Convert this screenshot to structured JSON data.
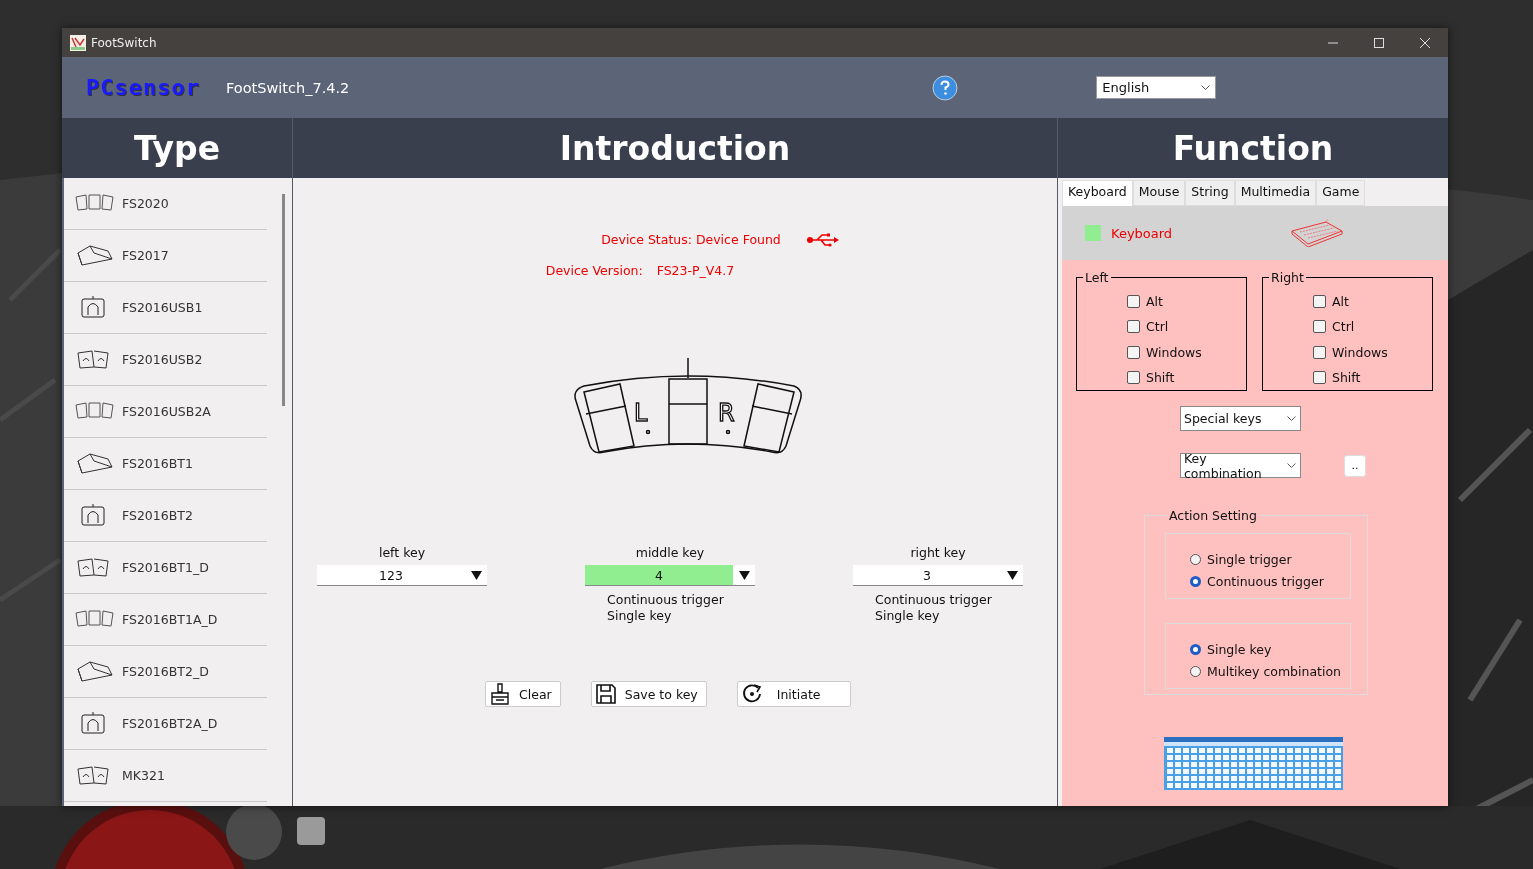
{
  "window": {
    "title": "FootSwitch"
  },
  "header": {
    "logo": "PCsensor",
    "app_version": "FootSwitch_7.4.2",
    "language": "English"
  },
  "columns": {
    "type": "Type",
    "introduction": "Introduction",
    "function": "Function"
  },
  "types": [
    {
      "label": "FS2020"
    },
    {
      "label": "FS2017"
    },
    {
      "label": "FS2016USB1"
    },
    {
      "label": "FS2016USB2"
    },
    {
      "label": "FS2016USB2A"
    },
    {
      "label": "FS2016BT1"
    },
    {
      "label": "FS2016BT2"
    },
    {
      "label": "FS2016BT1_D"
    },
    {
      "label": "FS2016BT1A_D"
    },
    {
      "label": "FS2016BT2_D"
    },
    {
      "label": "FS2016BT2A_D"
    },
    {
      "label": "MK321"
    }
  ],
  "device": {
    "status": "Device Status: Device Found",
    "version_label": "Device Version:",
    "version": "FS23-P_V4.7"
  },
  "pedal_letters": [
    "L",
    "R"
  ],
  "keys": [
    {
      "label": "left key",
      "value": "123",
      "selected": false
    },
    {
      "label": "middle key",
      "value": "4",
      "selected": true,
      "details": [
        "Continuous trigger",
        "Single key"
      ]
    },
    {
      "label": "right key",
      "value": "3",
      "selected": false,
      "details": [
        "Continuous trigger",
        "Single key"
      ]
    }
  ],
  "buttons": [
    {
      "label": "Clear",
      "kind": "clear"
    },
    {
      "label": "Save to key",
      "kind": "save"
    },
    {
      "label": "Initiate",
      "kind": "initiate"
    }
  ],
  "function_tabs": [
    {
      "label": "Keyboard",
      "selected": true
    },
    {
      "label": "Mouse",
      "selected": false
    },
    {
      "label": "String",
      "selected": false
    },
    {
      "label": "Multimedia",
      "selected": false
    },
    {
      "label": "Game",
      "selected": false
    }
  ],
  "keyboard_panel": {
    "title": "Keyboard"
  },
  "modifiers": [
    {
      "side": "Left",
      "keys": [
        {
          "label": "Alt",
          "checked": false
        },
        {
          "label": "Ctrl",
          "checked": false
        },
        {
          "label": "Windows",
          "checked": false
        },
        {
          "label": "Shift",
          "checked": false
        }
      ]
    },
    {
      "side": "Right",
      "keys": [
        {
          "label": "Alt",
          "checked": false
        },
        {
          "label": "Ctrl",
          "checked": false
        },
        {
          "label": "Windows",
          "checked": false
        },
        {
          "label": "Shift",
          "checked": false
        }
      ]
    }
  ],
  "special_keys": "Special keys",
  "key_combination": "Key combination",
  "more_button": "..",
  "action_setting": {
    "title": "Action Setting",
    "groups": [
      {
        "options": [
          {
            "label": "Single trigger",
            "selected": false
          },
          {
            "label": "Continuous trigger",
            "selected": true
          }
        ]
      },
      {
        "options": [
          {
            "label": "Single key",
            "selected": true
          },
          {
            "label": "Multikey  combination",
            "selected": false
          }
        ]
      }
    ]
  }
}
